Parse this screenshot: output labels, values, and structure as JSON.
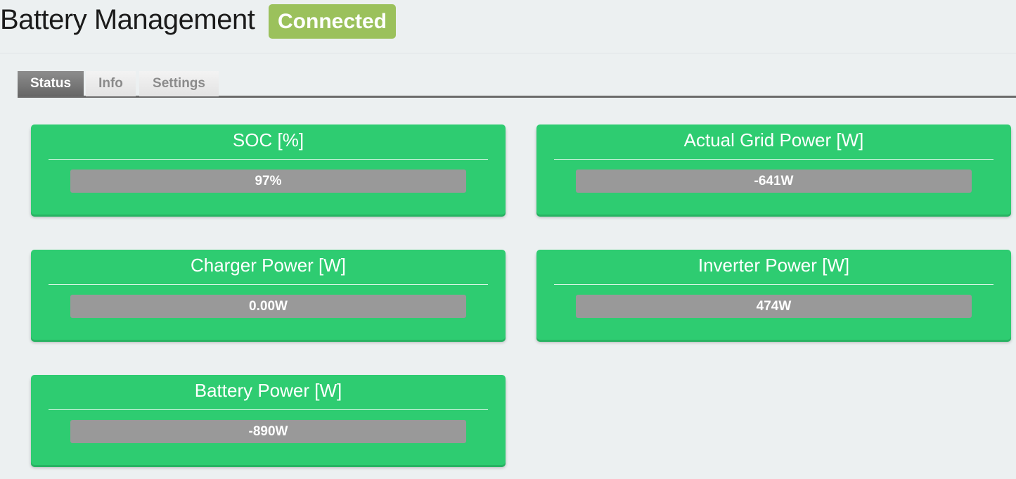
{
  "header": {
    "title": "Battery Management",
    "status_badge": "Connected"
  },
  "tabs": [
    {
      "label": "Status",
      "active": true
    },
    {
      "label": "Info",
      "active": false
    },
    {
      "label": "Settings",
      "active": false
    }
  ],
  "cards": {
    "soc": {
      "title": "SOC [%]",
      "value": "97%"
    },
    "grid_power": {
      "title": "Actual Grid Power [W]",
      "value": "-641W"
    },
    "charger_power": {
      "title": "Charger Power [W]",
      "value": "0.00W"
    },
    "inverter_power": {
      "title": "Inverter Power [W]",
      "value": "474W"
    },
    "battery_power": {
      "title": "Battery Power [W]",
      "value": "-890W"
    }
  },
  "colors": {
    "background": "#ecf0f1",
    "card": "#2ecc71",
    "badge": "#9bc15c",
    "value_bar": "#999999",
    "active_tab": "#6b6b6b"
  }
}
